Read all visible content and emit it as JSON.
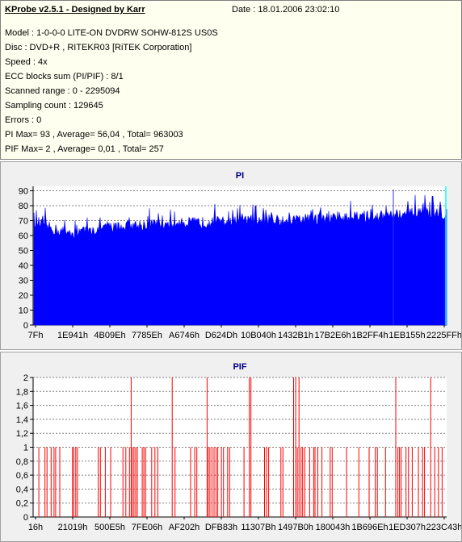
{
  "header": {
    "title": "KProbe v2.5.1 - Designed by Karr",
    "date": "Date : 18.01.2006 23:02:10",
    "lines": [
      "Model : 1-0-0-0 LITE-ON DVDRW SOHW-812S  US0S",
      "Disc : DVD+R , RITEKR03 [RiTEK Corporation]",
      "Speed : 4x",
      "ECC blocks sum (PI/PIF) : 8/1",
      "Scanned range : 0 - 2295094",
      "Sampling count : 129645",
      "Errors : 0",
      "PI Max= 93 , Average= 56,04 , Total= 963003",
      "PIF Max= 2 , Average= 0,01 , Total= 257"
    ]
  },
  "chart_data": [
    {
      "type": "area",
      "title": "PI",
      "ylim": [
        0,
        93
      ],
      "yticks": [
        0,
        10,
        20,
        30,
        40,
        50,
        60,
        70,
        80,
        90
      ],
      "ytick_labels": [
        "0",
        "10",
        "20",
        "30",
        "40",
        "50",
        "60",
        "70",
        "80",
        "90"
      ],
      "xtick_labels": [
        "7Fh",
        "1E941h",
        "4B09Eh",
        "7785Eh",
        "A6746h",
        "D624Dh",
        "10B040h",
        "1432B1h",
        "17B2E6h",
        "1B2FF4h",
        "1EB155h",
        "2225FFh"
      ],
      "grid": true,
      "color": "#0000ff",
      "max_marker_color": "#00ffff",
      "profile": [
        [
          0.0,
          70
        ],
        [
          0.03,
          66
        ],
        [
          0.06,
          63
        ],
        [
          0.1,
          62
        ],
        [
          0.13,
          63
        ],
        [
          0.18,
          65
        ],
        [
          0.25,
          67
        ],
        [
          0.35,
          68
        ],
        [
          0.45,
          69
        ],
        [
          0.55,
          70
        ],
        [
          0.65,
          71
        ],
        [
          0.75,
          72
        ],
        [
          0.85,
          73
        ],
        [
          0.93,
          75
        ],
        [
          1.0,
          75
        ]
      ]
    },
    {
      "type": "bar",
      "title": "PIF",
      "ylim": [
        0,
        2
      ],
      "yticks": [
        0,
        0.2,
        0.4,
        0.6,
        0.8,
        1,
        1.2,
        1.4,
        1.6,
        1.8,
        2
      ],
      "ytick_labels": [
        "0",
        "0,2",
        "0,4",
        "0,6",
        "0,8",
        "1",
        "1,2",
        "1,4",
        "1,6",
        "1,8",
        "2"
      ],
      "xtick_labels": [
        "16h",
        "21019h",
        "500E5h",
        "7FE06h",
        "AF202h",
        "DFB83h",
        "11307Bh",
        "1497B0h",
        "180043h",
        "1B696Eh",
        "1ED307h",
        "223C43h"
      ],
      "grid": true,
      "color": "#ff0000",
      "x": [
        0.01,
        0.025,
        0.03,
        0.04,
        0.047,
        0.051,
        0.061,
        0.092,
        0.095,
        0.1,
        0.104,
        0.155,
        0.16,
        0.172,
        0.185,
        0.215,
        0.222,
        0.231,
        0.235,
        0.238,
        0.242,
        0.246,
        0.25,
        0.262,
        0.266,
        0.27,
        0.285,
        0.293,
        0.3,
        0.335,
        0.342,
        0.38,
        0.39,
        0.395,
        0.42,
        0.423,
        0.427,
        0.432,
        0.437,
        0.442,
        0.446,
        0.455,
        0.46,
        0.47,
        0.475,
        0.51,
        0.523,
        0.527,
        0.56,
        0.565,
        0.57,
        0.6,
        0.605,
        0.631,
        0.636,
        0.64,
        0.644,
        0.649,
        0.653,
        0.658,
        0.67,
        0.68,
        0.683,
        0.69,
        0.7,
        0.72,
        0.725,
        0.76,
        0.79,
        0.815,
        0.83,
        0.835,
        0.855,
        0.88,
        0.885,
        0.889,
        0.893,
        0.905,
        0.911,
        0.92,
        0.935,
        0.945,
        0.95,
        0.965,
        0.975,
        0.984,
        0.993
      ],
      "values": [
        1,
        1,
        1,
        1,
        1,
        1,
        1,
        1,
        1,
        1,
        1,
        1,
        1,
        1,
        1,
        1,
        1,
        1,
        2,
        1,
        1,
        1,
        1,
        1,
        1,
        1,
        1,
        1,
        1,
        2,
        1,
        1,
        1,
        1,
        2,
        1,
        1,
        1,
        1,
        1,
        1,
        1,
        1,
        1,
        1,
        1,
        2,
        2,
        1,
        1,
        1,
        1,
        1,
        2,
        2,
        1,
        2,
        1,
        1,
        1,
        1,
        1,
        1,
        1,
        1,
        1,
        1,
        1,
        1,
        1,
        1,
        1,
        1,
        2,
        1,
        1,
        1,
        1,
        1,
        1,
        1,
        1,
        1,
        2,
        1,
        1,
        1
      ]
    }
  ]
}
